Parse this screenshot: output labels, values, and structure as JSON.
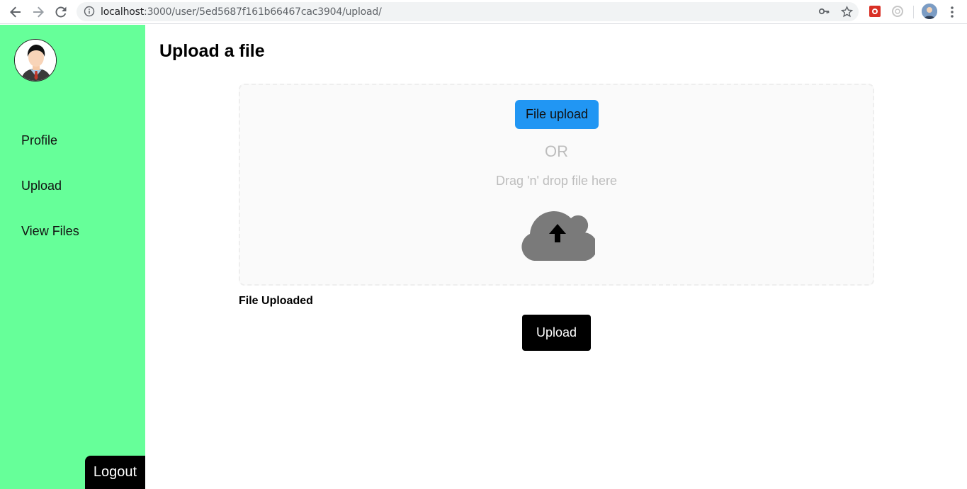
{
  "browser": {
    "url_host": "localhost",
    "url_path": ":3000/user/5ed5687f161b66467cac3904/upload/",
    "icons": [
      "back-icon",
      "forward-icon",
      "reload-icon",
      "info-icon",
      "key-icon",
      "star-icon",
      "extension-icon",
      "extension-icon-2",
      "profile-avatar",
      "menu-icon"
    ]
  },
  "sidebar": {
    "items": [
      {
        "label": "Profile"
      },
      {
        "label": "Upload"
      },
      {
        "label": "View Files"
      }
    ],
    "logout_label": "Logout",
    "background": "#66ff99"
  },
  "main": {
    "title": "Upload a file",
    "dropzone": {
      "button_label": "File upload",
      "or_text": "OR",
      "drag_text": "Drag 'n' drop file here"
    },
    "status_text": "File Uploaded",
    "upload_label": "Upload"
  },
  "colors": {
    "accent_blue": "#2196f3",
    "sidebar_green": "#66ff99",
    "button_black": "#000000"
  }
}
